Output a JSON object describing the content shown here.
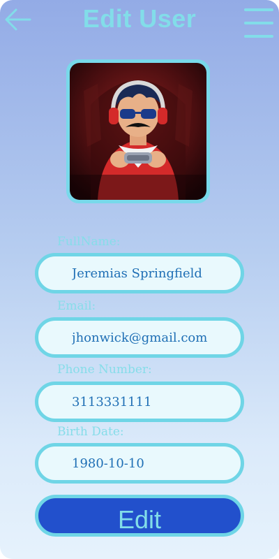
{
  "header": {
    "title": "Edit User",
    "back_icon": "arrow-left-icon",
    "menu_icon": "hamburger-menu-icon"
  },
  "avatar": {
    "description_icon": "gamer-avatar-image"
  },
  "form": {
    "fullname": {
      "label": "FullName:",
      "value": "Jeremias Springfield"
    },
    "email": {
      "label": "Email:",
      "value": "jhonwick@gmail.com"
    },
    "phone": {
      "label": "Phone Number:",
      "value": "3113331111"
    },
    "birthdate": {
      "label": "Birth Date:",
      "value": "1980-10-10"
    }
  },
  "actions": {
    "edit_label": "Edit"
  },
  "colors": {
    "accent": "#82dde9",
    "border": "#6fd5e6",
    "button_bg": "#2250cc",
    "input_text": "#1f6fb5"
  }
}
